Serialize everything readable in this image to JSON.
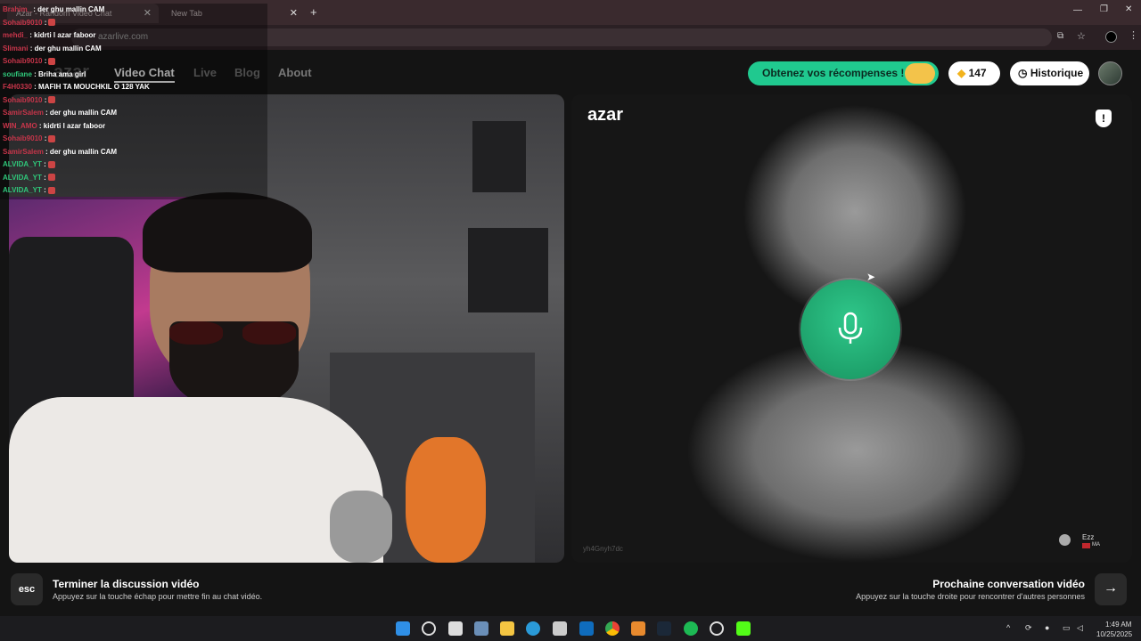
{
  "browser": {
    "tabs": [
      {
        "label": "Azar - Random Video Chat"
      },
      {
        "label": "New Tab"
      }
    ],
    "url": "azarlive.com"
  },
  "site": {
    "logo": "azar",
    "nav": [
      "Video Chat",
      "Live",
      "Blog",
      "About"
    ],
    "reward_label": "Obtenez vos récompenses !",
    "gems": "147",
    "history_label": "Historique"
  },
  "remote": {
    "watermark": "azar",
    "user_id": "yh4Gnyh7dc",
    "partner_name": "Ezz",
    "partner_country": "MA"
  },
  "bottom": {
    "esc_key": "esc",
    "end_title": "Terminer la discussion vidéo",
    "end_hint": "Appuyez sur la touche échap pour mettre fin au chat vidéo.",
    "next_title": "Prochaine conversation vidéo",
    "next_hint": "Appuyez sur la touche droite pour rencontrer d'autres personnes"
  },
  "taskbar": {
    "time": "1:49 AM",
    "date": "10/25/2025"
  },
  "chat": [
    {
      "user": "Brahim_",
      "msg": ": der ghu mallin CAM"
    },
    {
      "user": "Sohaib9010",
      "msg": ":"
    },
    {
      "user": "mehdi_",
      "msg": ": kidrti l azar faboor"
    },
    {
      "user": "Slimani",
      "msg": ": der ghu mallin CAM"
    },
    {
      "user": "Sohaib9010",
      "msg": ":"
    },
    {
      "user": "soufiane",
      "msg": ": Briha ama girl"
    },
    {
      "user": "F4H0330",
      "msg": ": MAFIH TA MOUCHKIL O 128 YAK"
    },
    {
      "user": "Sohaib9010",
      "msg": ":"
    },
    {
      "user": "SamirSalem",
      "msg": ": der ghu mallin CAM"
    },
    {
      "user": "WIN_AMO",
      "msg": ": kidrti l azar faboor"
    },
    {
      "user": "Sohaib9010",
      "msg": ":"
    },
    {
      "user": "SamirSalem",
      "msg": ": der ghu mallin CAM"
    },
    {
      "user": "ALVIDA_YT",
      "msg": ":"
    },
    {
      "user": "ALVIDA_YT",
      "msg": ":"
    },
    {
      "user": "ALVIDA_YT",
      "msg": ":"
    }
  ],
  "colors": {
    "accent": "#20c98f",
    "bg": "#141414"
  },
  "icons": [
    "mic-icon",
    "shield-icon",
    "clock-icon",
    "gem-icon",
    "gift-icon",
    "arrow-right-icon",
    "windows-icon",
    "search-icon"
  ]
}
